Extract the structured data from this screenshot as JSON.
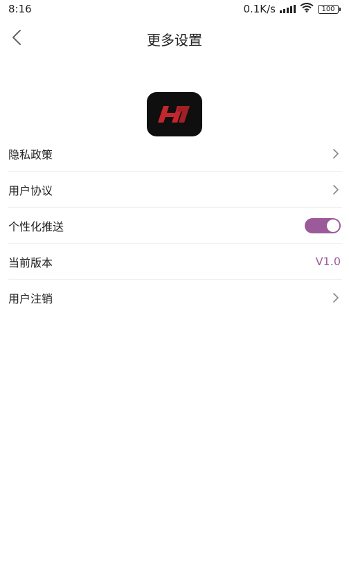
{
  "status_bar": {
    "time": "8:16",
    "network_speed": "0.1K/s",
    "battery": "100",
    "icons": [
      "signal-icon",
      "wifi-icon",
      "battery-icon"
    ]
  },
  "nav": {
    "title": "更多设置",
    "back_icon": "chevron-left-icon"
  },
  "logo": {
    "name": "app-logo",
    "background": "#0f0f0f",
    "accent": "#c1272d"
  },
  "settings": {
    "items": [
      {
        "label": "隐私政策",
        "trailing": "chevron-right-icon"
      },
      {
        "label": "用户协议",
        "trailing": "chevron-right-icon"
      },
      {
        "label": "个性化推送",
        "trailing": "toggle",
        "toggle_on": true
      },
      {
        "label": "当前版本",
        "trailing": "value",
        "value": "V1.0"
      },
      {
        "label": "用户注销",
        "trailing": "chevron-right-icon"
      }
    ]
  },
  "colors": {
    "accent": "#9b5a9a",
    "text": "#222222",
    "divider": "#f0f0f0",
    "chevron": "#888888"
  }
}
